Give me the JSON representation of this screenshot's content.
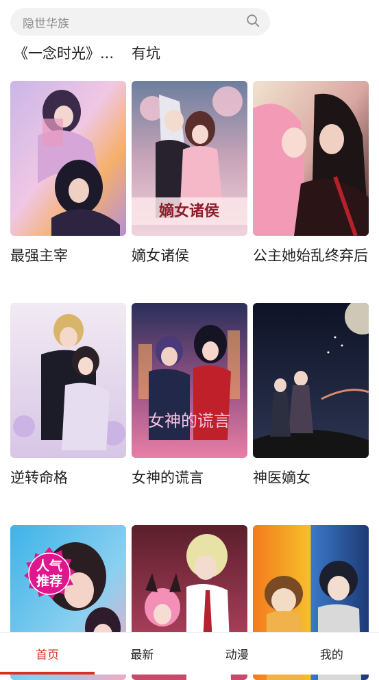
{
  "search": {
    "placeholder": "隐世华族"
  },
  "suggestions": [
    "《一念时光》...",
    "有坑"
  ],
  "books": [
    {
      "title": "最强主宰"
    },
    {
      "title": "嫡女诸侯",
      "cover_text": "嫡女诸侯"
    },
    {
      "title": "公主她始乱终弃后"
    },
    {
      "title": "逆转命格"
    },
    {
      "title": "女神的谎言",
      "cover_text": "女神的谎言"
    },
    {
      "title": "神医嫡女"
    },
    {
      "title": "",
      "badge": [
        "人气",
        "推荐"
      ]
    },
    {
      "title": ""
    },
    {
      "title": ""
    }
  ],
  "tabs": [
    {
      "label": "首页",
      "active": true
    },
    {
      "label": "最新"
    },
    {
      "label": "动漫"
    },
    {
      "label": "我的"
    }
  ],
  "colors": {
    "accent": "#d9311e",
    "badge": "#e0168f"
  }
}
